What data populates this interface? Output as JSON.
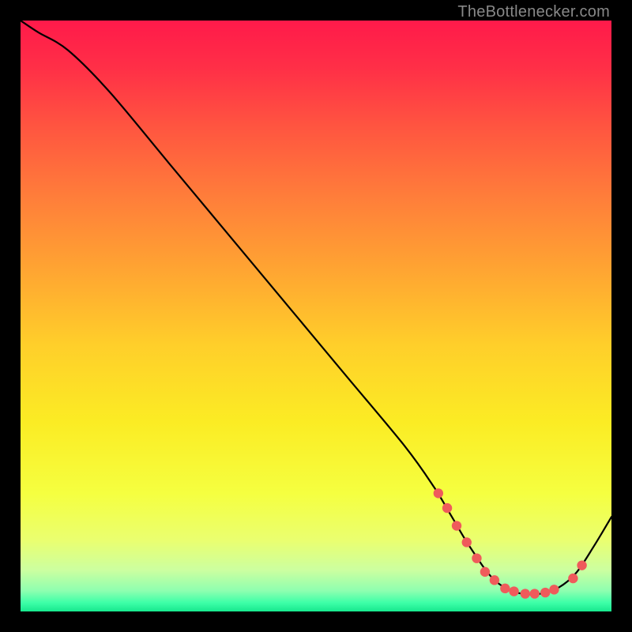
{
  "attribution": "TheBottlenecker.com",
  "chart_data": {
    "type": "line",
    "title": "",
    "xlabel": "",
    "ylabel": "",
    "xlim": [
      0,
      100
    ],
    "ylim": [
      0,
      100
    ],
    "series": [
      {
        "name": "curve",
        "x": [
          0,
          3,
          8,
          15,
          25,
          35,
          45,
          55,
          65,
          70,
          73,
          76,
          80,
          84,
          88,
          91,
          94,
          97,
          100
        ],
        "values": [
          100,
          98,
          95,
          88,
          76,
          64,
          52,
          40,
          28,
          21,
          16,
          11,
          5.5,
          3.2,
          3.0,
          4.0,
          6.5,
          11,
          16
        ]
      }
    ],
    "markers": [
      {
        "x": 70.7,
        "y": 20.0
      },
      {
        "x": 72.2,
        "y": 17.5
      },
      {
        "x": 73.8,
        "y": 14.5
      },
      {
        "x": 75.5,
        "y": 11.7
      },
      {
        "x": 77.2,
        "y": 9.0
      },
      {
        "x": 78.6,
        "y": 6.7
      },
      {
        "x": 80.2,
        "y": 5.3
      },
      {
        "x": 82.0,
        "y": 3.9
      },
      {
        "x": 83.5,
        "y": 3.4
      },
      {
        "x": 85.4,
        "y": 3.0
      },
      {
        "x": 87.0,
        "y": 3.0
      },
      {
        "x": 88.8,
        "y": 3.2
      },
      {
        "x": 90.3,
        "y": 3.7
      },
      {
        "x": 93.5,
        "y": 5.6
      },
      {
        "x": 95.0,
        "y": 7.8
      }
    ],
    "gradient_stops": [
      {
        "offset": 0.0,
        "color": "#ff1a4a"
      },
      {
        "offset": 0.08,
        "color": "#ff2f47"
      },
      {
        "offset": 0.18,
        "color": "#ff5540"
      },
      {
        "offset": 0.3,
        "color": "#ff7e3a"
      },
      {
        "offset": 0.42,
        "color": "#ffa432"
      },
      {
        "offset": 0.55,
        "color": "#ffcf2a"
      },
      {
        "offset": 0.68,
        "color": "#fbec24"
      },
      {
        "offset": 0.8,
        "color": "#f5ff40"
      },
      {
        "offset": 0.88,
        "color": "#eaff70"
      },
      {
        "offset": 0.93,
        "color": "#ccffa0"
      },
      {
        "offset": 0.965,
        "color": "#8effb0"
      },
      {
        "offset": 0.985,
        "color": "#3effa8"
      },
      {
        "offset": 1.0,
        "color": "#17e88e"
      }
    ]
  }
}
